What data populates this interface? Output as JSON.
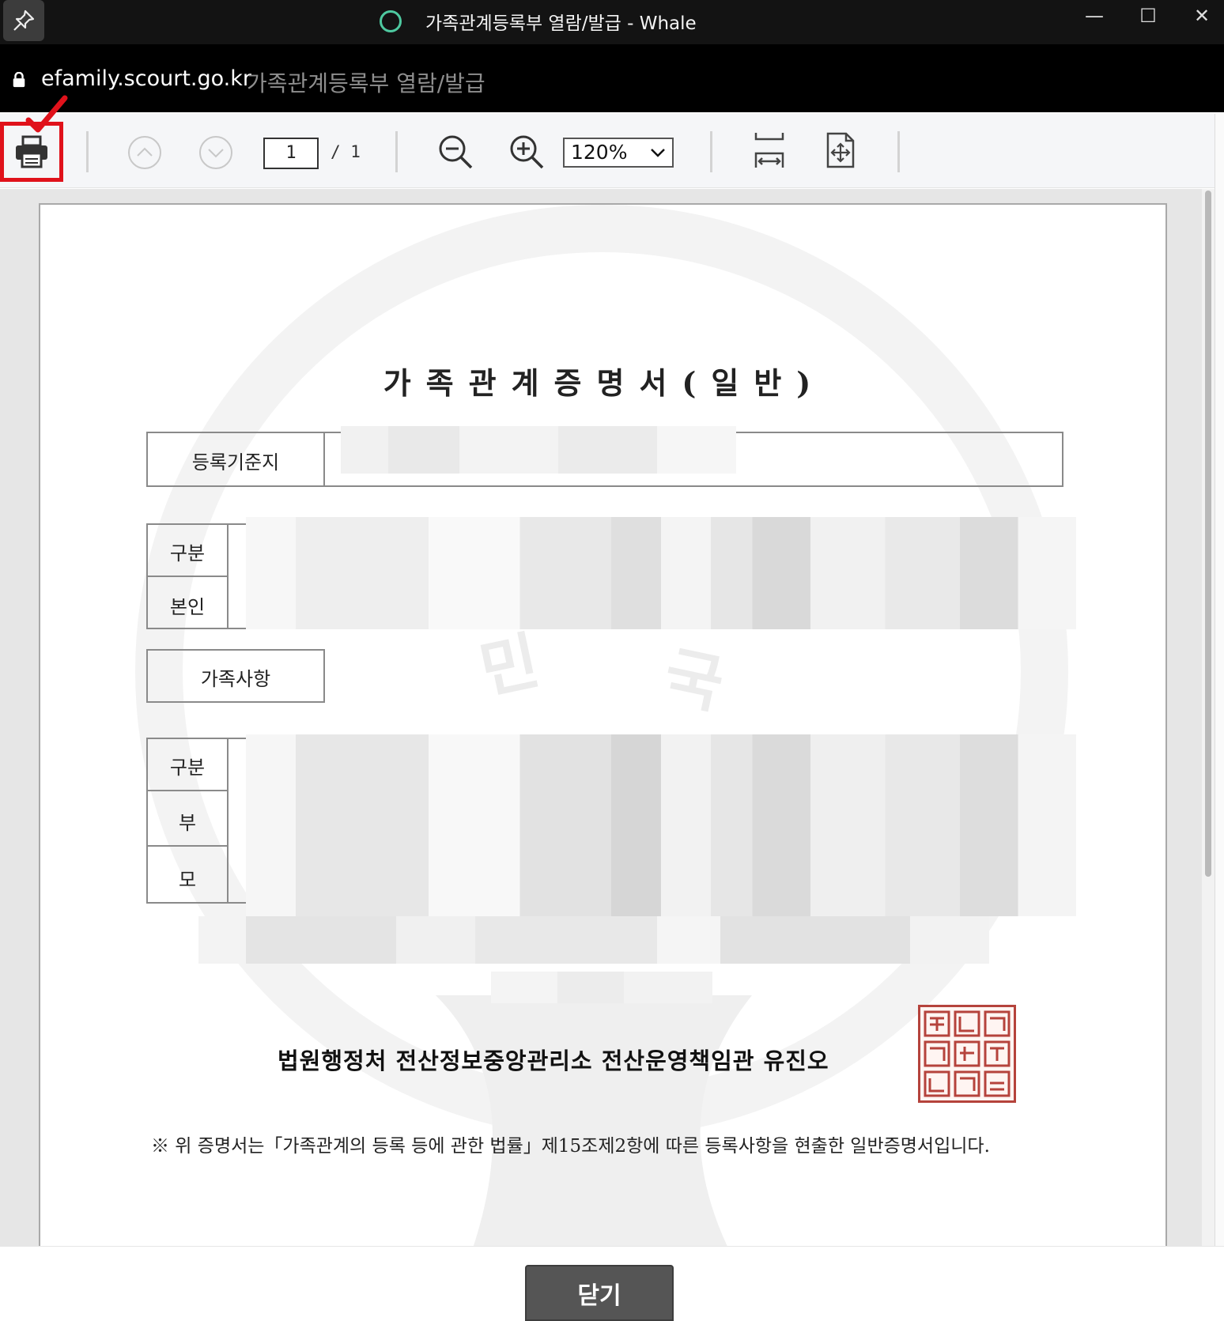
{
  "window": {
    "title": "가족관계등록부 열람/발급 - Whale",
    "controls": {
      "minimize": "—",
      "maximize": "☐",
      "close": "✕"
    }
  },
  "address_bar": {
    "domain": "efamily.scourt.go.kr",
    "page_title": "가족관계등록부 열람/발급"
  },
  "toolbar": {
    "page_current": "1",
    "page_total": "/ 1",
    "zoom": "120%",
    "highlight_color": "#e0121b"
  },
  "document": {
    "title": "가족관계증명서(일반)",
    "rows": {
      "registration_base": "등록기준지",
      "category": "구분",
      "self": "본인",
      "family_section": "가족사항",
      "category2": "구분",
      "father": "부",
      "mother": "모"
    },
    "authority": "법원행정처 전산정보중앙관리소 전산운영책임관 유진오",
    "note": "※ 위 증명서는「가족관계의 등록 등에 관한 법률」제15조제2항에 따른 등록사항을 현출한 일반증명서입니다."
  },
  "footer": {
    "close_label": "닫기"
  }
}
